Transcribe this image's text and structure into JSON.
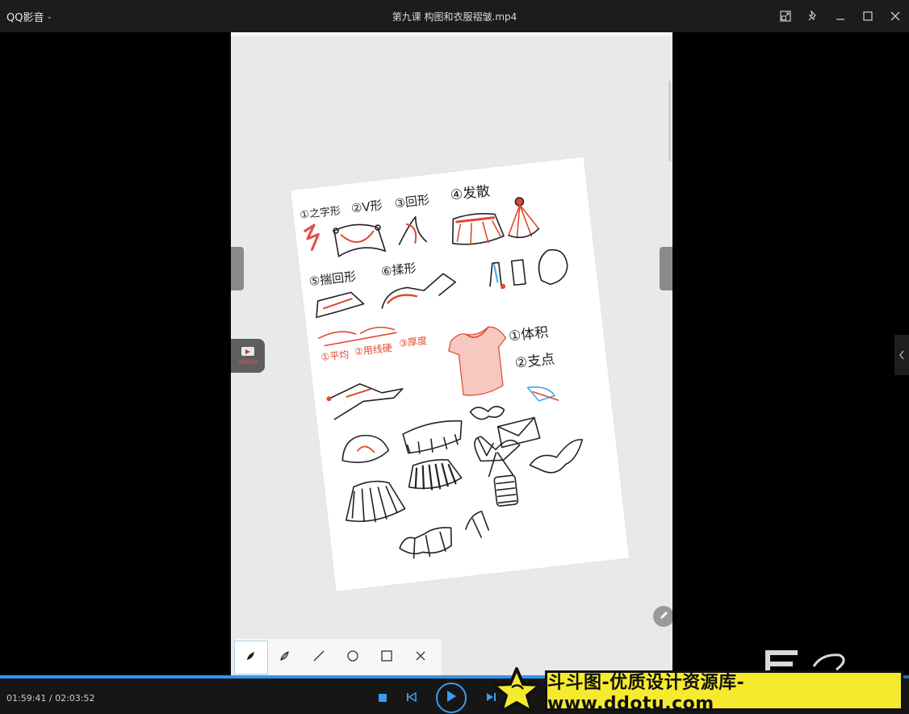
{
  "app": {
    "name": "QQ影音"
  },
  "window": {
    "file_title": "第九课 构图和衣服褶皱.mp4"
  },
  "overlay": {
    "record_button_label": "录制视频"
  },
  "player": {
    "current_time": "01:59:41",
    "separator": " / ",
    "total_time": "02:03:52",
    "progress": 0.967
  },
  "watermark": {
    "text": "斗斗图-优质设计资源库-www.ddotu.com"
  },
  "sketch": {
    "header_labels": [
      "①之字形",
      "②V形",
      "③回形",
      "④发散"
    ],
    "row2_labels": [
      "⑤揣回形",
      "⑥揉形"
    ],
    "row3_labels": [
      "①平均",
      "②用线硬",
      "③厚度"
    ],
    "side_labels": [
      "①体积",
      "②支点"
    ]
  },
  "colors": {
    "accent": "#2f95ee",
    "sketch_red": "#e0482f",
    "sketch_blue": "#4aa3e6",
    "watermark_bg": "#f6ea2f"
  }
}
